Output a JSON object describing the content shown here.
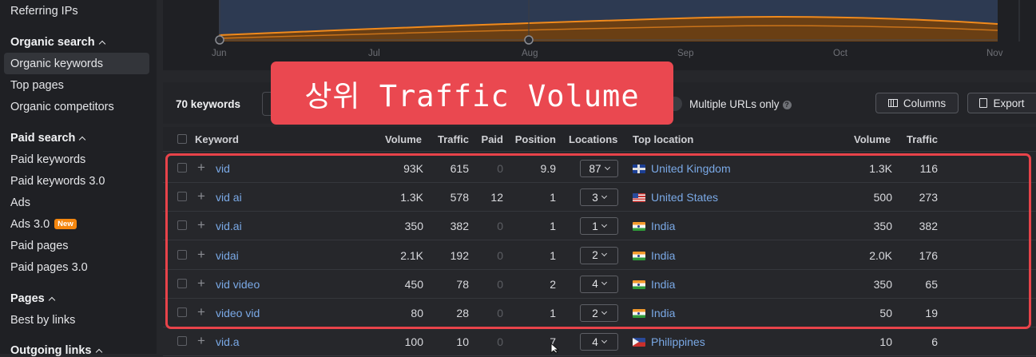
{
  "sidebar": {
    "referring_ips": "Referring IPs",
    "organic_search": {
      "heading": "Organic search",
      "items": [
        "Organic keywords",
        "Top pages",
        "Organic competitors"
      ]
    },
    "paid_search": {
      "heading": "Paid search",
      "items": [
        "Paid keywords",
        "Paid keywords 3.0",
        "Ads",
        "Ads 3.0",
        "Paid pages",
        "Paid pages 3.0"
      ],
      "new_badge": "New"
    },
    "pages": {
      "heading": "Pages",
      "items": [
        "Best by links"
      ]
    },
    "outgoing_links": {
      "heading": "Outgoing links"
    }
  },
  "chart": {
    "months": [
      "Jun",
      "Jul",
      "Aug",
      "Sep",
      "Oct",
      "Nov"
    ]
  },
  "toolbar": {
    "keyword_count": "70 keywords",
    "multiple_urls": "Multiple URLs only",
    "columns_label": "Columns",
    "export_label": "Export"
  },
  "table": {
    "headers": {
      "keyword": "Keyword",
      "volume": "Volume",
      "traffic": "Traffic",
      "paid": "Paid",
      "position": "Position",
      "locations": "Locations",
      "top_location": "Top location",
      "tl_volume": "Volume",
      "tl_traffic": "Traffic"
    },
    "rows": [
      {
        "keyword": "vid",
        "volume": "93K",
        "traffic": "615",
        "paid": "0",
        "position": "9.9",
        "locations": "87",
        "country": "United Kingdom",
        "flag": "uk",
        "tl_volume": "1.3K",
        "tl_traffic": "116"
      },
      {
        "keyword": "vid ai",
        "volume": "1.3K",
        "traffic": "578",
        "paid": "12",
        "position": "1",
        "locations": "3",
        "country": "United States",
        "flag": "us",
        "tl_volume": "500",
        "tl_traffic": "273"
      },
      {
        "keyword": "vid.ai",
        "volume": "350",
        "traffic": "382",
        "paid": "0",
        "position": "1",
        "locations": "1",
        "country": "India",
        "flag": "in",
        "tl_volume": "350",
        "tl_traffic": "382"
      },
      {
        "keyword": "vidai",
        "volume": "2.1K",
        "traffic": "192",
        "paid": "0",
        "position": "1",
        "locations": "2",
        "country": "India",
        "flag": "in",
        "tl_volume": "2.0K",
        "tl_traffic": "176"
      },
      {
        "keyword": "vid video",
        "volume": "450",
        "traffic": "78",
        "paid": "0",
        "position": "2",
        "locations": "4",
        "country": "India",
        "flag": "in",
        "tl_volume": "350",
        "tl_traffic": "65"
      },
      {
        "keyword": "video vid",
        "volume": "80",
        "traffic": "28",
        "paid": "0",
        "position": "1",
        "locations": "2",
        "country": "India",
        "flag": "in",
        "tl_volume": "50",
        "tl_traffic": "19"
      },
      {
        "keyword": "vid.a",
        "volume": "100",
        "traffic": "10",
        "paid": "0",
        "position": "7",
        "locations": "4",
        "country": "Philippines",
        "flag": "ph",
        "tl_volume": "10",
        "tl_traffic": "6"
      }
    ]
  },
  "overlay": {
    "banner_text": "상위 Traffic Volume",
    "accent_color": "#ea4850"
  }
}
